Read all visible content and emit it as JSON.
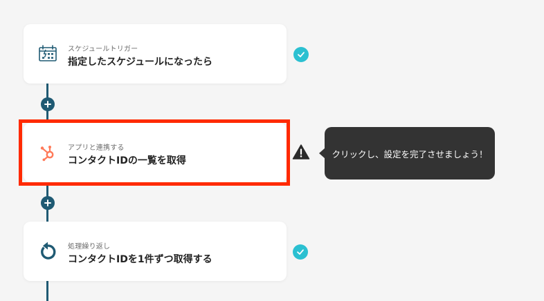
{
  "flow": {
    "steps": [
      {
        "sub_label": "スケジュールトリガー",
        "title": "指定したスケジュールになったら",
        "icon": "calendar-schedule-icon",
        "status": "complete"
      },
      {
        "sub_label": "アプリと連携する",
        "title": "コンタクトIDの一覧を取得",
        "icon": "hubspot-icon",
        "status": "warning"
      },
      {
        "sub_label": "処理繰り返し",
        "title": "コンタクトIDを1件ずつ取得する",
        "icon": "loop-icon",
        "status": "complete"
      }
    ],
    "tooltip": {
      "text": "クリックし、設定を完了させましょう！"
    }
  },
  "colors": {
    "connector": "#1f5a73",
    "check": "#2bc0d1",
    "highlight": "#ff2a00",
    "hubspot": "#ff7a59",
    "tooltip_bg": "#333333"
  }
}
